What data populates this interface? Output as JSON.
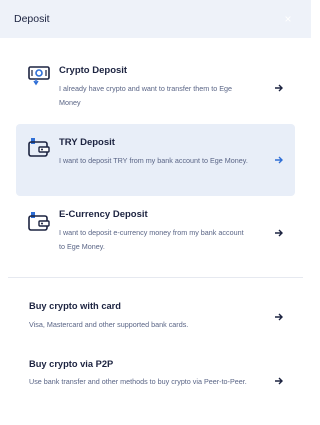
{
  "header": {
    "title": "Deposit",
    "close_glyph": "×"
  },
  "options": [
    {
      "title": "Crypto Deposit",
      "desc": "I already have crypto and want to transfer them to Ege Money",
      "icon": "crypto-deposit-icon",
      "selected": false
    },
    {
      "title": "TRY Deposit",
      "desc": "I want to deposit TRY from my bank account to Ege Money.",
      "icon": "wallet-icon",
      "selected": true
    },
    {
      "title": "E-Currency Deposit",
      "desc": "I want to deposit e-currency money from my bank account to Ege Money.",
      "icon": "wallet-icon",
      "selected": false
    }
  ],
  "buy": [
    {
      "title": "Buy crypto with card",
      "desc": "Visa, Mastercard and other supported bank cards."
    },
    {
      "title": "Buy crypto via P2P",
      "desc": "Use bank transfer and other methods to buy crypto via Peer-to-Peer."
    }
  ],
  "colors": {
    "accent": "#2f6fd6",
    "selected_bg": "#e8eef8",
    "header_bg": "#eef2f9",
    "text": "#1c2340",
    "muted": "#5a6586"
  }
}
